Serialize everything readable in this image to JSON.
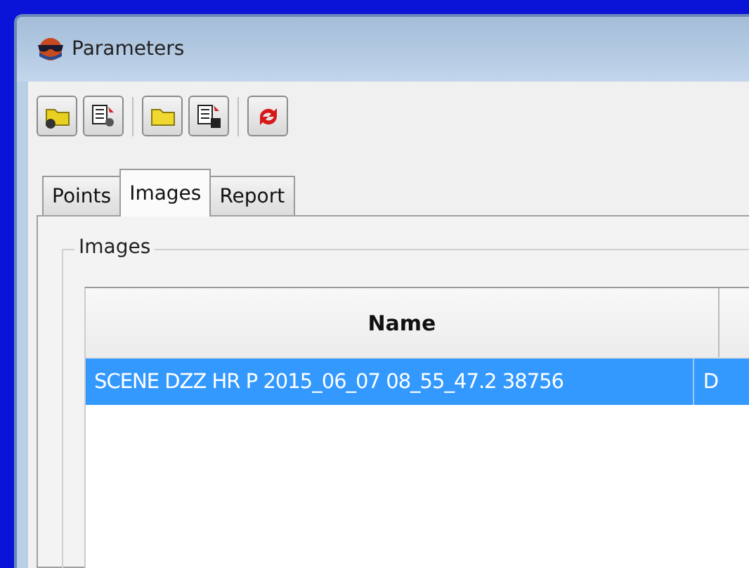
{
  "window": {
    "title": "Parameters"
  },
  "tabs": [
    {
      "label": "Points",
      "selected": false
    },
    {
      "label": "Images",
      "selected": true
    },
    {
      "label": "Report",
      "selected": false
    }
  ],
  "group": {
    "title": "Images"
  },
  "table": {
    "columns": [
      "Name"
    ],
    "rows": [
      {
        "cells": [
          "SCENE DZZ HR P 2015_06_07 08_55_47.2 38756",
          "D"
        ],
        "selected": true
      }
    ]
  }
}
